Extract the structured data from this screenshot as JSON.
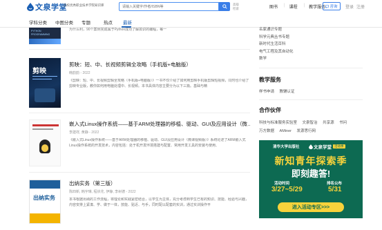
{
  "header": {
    "logo_text": "文泉学堂",
    "tagline": "高校优秀职业技术学院知识库",
    "search_placeholder": "请输入关键字/作者/ISBN等",
    "advanced_search": "高级检索",
    "links": [
      "图书",
      "课程",
      "教学服务"
    ],
    "consult_label": "咨询",
    "login_label": "登录",
    "register_label": "注册"
  },
  "tabs": [
    "学科分类",
    "中图分类",
    "专题",
    "热点",
    "最新"
  ],
  "books": [
    {
      "title": "",
      "meta": "",
      "desc": "为什么利，90个案例完成属于Python成功了解如识的编程，每一",
      "cover_text": "PYTHON PROGRAMMING"
    },
    {
      "title": "剪映：短、中、长视频剪辑全攻略（手机版+电脑版）",
      "meta": "韩韵韵 - 2022",
      "desc": "《剪映：短、中、长视频剪辑全攻略（手机版+电脑版）》一书不仅介绍了如何用剪映手机版剪辑短视频，同时也介绍了剪映专业版，教你如何用电脑处理中、长视频。本书具体内容主要分为以下三篇。基础与精",
      "cover_text": "剪映"
    },
    {
      "title": "嵌入式Linux操作系统——基于ARM处理器的移植、驱动、GUI及应用设计（微…",
      "meta": "李建祥, 黄静 - 2022",
      "desc": "《嵌入式Linux操作系统——基于ARM处理器的移植、驱动、GUI及应用设计（微课视频版）》系统论述了ARM嵌入式Linux操作系统的开发技术，内容包括：处于机开发环境搭建与配置、常用开发工具的安装与使用、",
      "cover_text": ""
    },
    {
      "title": "出纳实务（第三版）",
      "meta": "陈四新, 韩宇琳, 程状花, 伊静, 李树德 - 2022",
      "desc": "本书根据出纳的工作流程，将理论和实践紧密结合，以学生为主体，充分考虑到学生已有的知识、技能、经验与兴趣，内容安排上紧凑、学、做于一体，技能、贴近、与手，同时配以配套的实训，通过实训操作平",
      "cover_text": "出纳实务"
    }
  ],
  "sidebar": {
    "top_items": [
      "名家通识专题",
      "科学元典丛书专题",
      "新时代生活百科",
      "电气工程及其自动化",
      "数学"
    ],
    "teaching_title": "教学服务",
    "teaching_links": [
      "样书申请",
      "教辅认证"
    ],
    "partners_title": "合作伙伴",
    "partners_row1": [
      "科技与标准服务实验室",
      "文泉智治",
      "共享源",
      "书问"
    ],
    "partners_row2": [
      "万方数据",
      "AMiner",
      "发源思行网"
    ]
  },
  "banner": {
    "publisher": "清华大学出版社",
    "logo_text": "文泉学堂",
    "badge": "活动季",
    "headline_1": "新知青年探索季",
    "headline_2": "即刻趣答!",
    "time_label": "活动时间",
    "time_value": "3/27~5/29",
    "signup_label": "排名公布",
    "signup_value": "5/31",
    "cta": "进入活动专区>>>"
  },
  "colors": {
    "brand_blue": "#1a5fb4",
    "search_blue": "#3a7ee8",
    "banner_green": "#0d6a52",
    "banner_accent": "#f7d23b"
  }
}
